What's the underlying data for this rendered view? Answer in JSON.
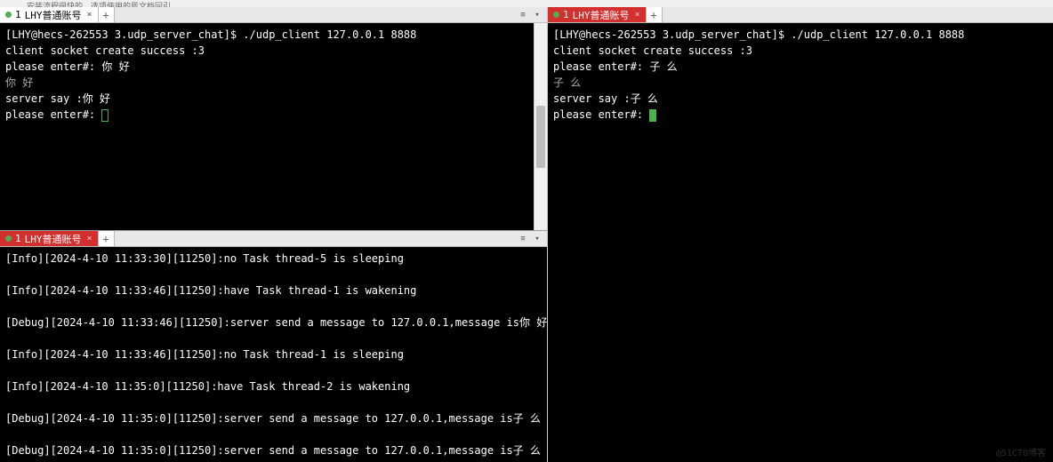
{
  "top_hint": "安装流程很快的，选项使用的鳯文档回引。",
  "panes": {
    "top_left": {
      "tab": {
        "index": "1",
        "title": "LHY普通账号"
      },
      "add": "+",
      "lines": [
        "[LHY@hecs-262553 3.udp_server_chat]$ ./udp_client 127.0.0.1 8888",
        "client socket create success :3",
        "please enter#: 你 好",
        "你 好",
        "server say :你 好",
        "please enter#: "
      ]
    },
    "right": {
      "tab": {
        "index": "1",
        "title": "LHY普通账号"
      },
      "add": "+",
      "lines": [
        "[LHY@hecs-262553 3.udp_server_chat]$ ./udp_client 127.0.0.1 8888",
        "client socket create success :3",
        "please enter#: 子 么",
        "子 么",
        "server say :子 么",
        "please enter#: "
      ]
    },
    "bottom_left": {
      "tab": {
        "index": "1",
        "title": "LHY普通账号"
      },
      "add": "+",
      "lines": [
        "[Info][2024-4-10 11:33:30][11250]:no Task thread-5 is sleeping",
        "",
        "[Info][2024-4-10 11:33:46][11250]:have Task thread-1 is wakening",
        "",
        "[Debug][2024-4-10 11:33:46][11250]:server send a message to 127.0.0.1,message is你 好",
        "",
        "[Info][2024-4-10 11:33:46][11250]:no Task thread-1 is sleeping",
        "",
        "[Info][2024-4-10 11:35:0][11250]:have Task thread-2 is wakening",
        "",
        "[Debug][2024-4-10 11:35:0][11250]:server send a message to 127.0.0.1,message is子 么",
        "",
        "[Debug][2024-4-10 11:35:0][11250]:server send a message to 127.0.0.1,message is子 么",
        ""
      ]
    }
  },
  "watermark": "@51CTO博客"
}
